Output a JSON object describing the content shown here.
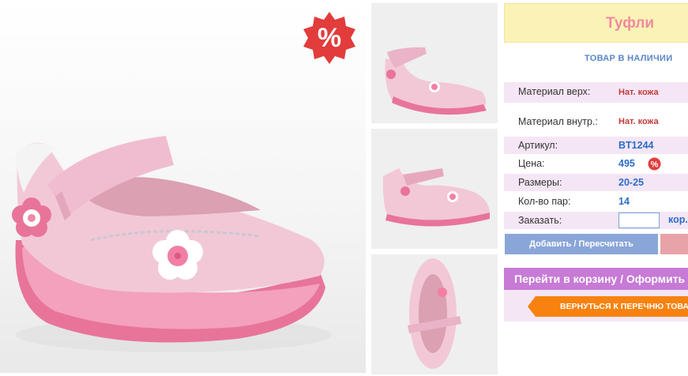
{
  "product": {
    "title": "Туфли",
    "stock_status": "ТОВАР В НАЛИЧИИ",
    "sale_badge": "%"
  },
  "details": [
    {
      "label": "Материал верх:",
      "value": "Нат. кожа"
    },
    {
      "label": "Материал внутр.:",
      "value": "Нат. кожа"
    },
    {
      "label": "Артикул:",
      "value": "BT1244"
    },
    {
      "label": "Цена:",
      "value": "495"
    },
    {
      "label": "Размеры:",
      "value": "20-25"
    },
    {
      "label": "Кол-во пар:",
      "value": "14"
    }
  ],
  "order": {
    "label": "Заказать:",
    "quantity_value": "",
    "unit": "кор."
  },
  "buttons": {
    "add": "Добавить / Пересчитать",
    "cart": "Перейти в корзину / Оформить заказ",
    "back": "ВЕРНУТЬСЯ К ПЕРЕЧНЮ ТОВАРОВ"
  },
  "colors": {
    "shoe_pink": "#f2c8d6",
    "sole_pink": "#e8749a",
    "accent_blue": "#2a6dc9",
    "title_pink": "#f08aa0",
    "cart_purple": "#c77ad6",
    "back_orange": "#f7820f"
  }
}
